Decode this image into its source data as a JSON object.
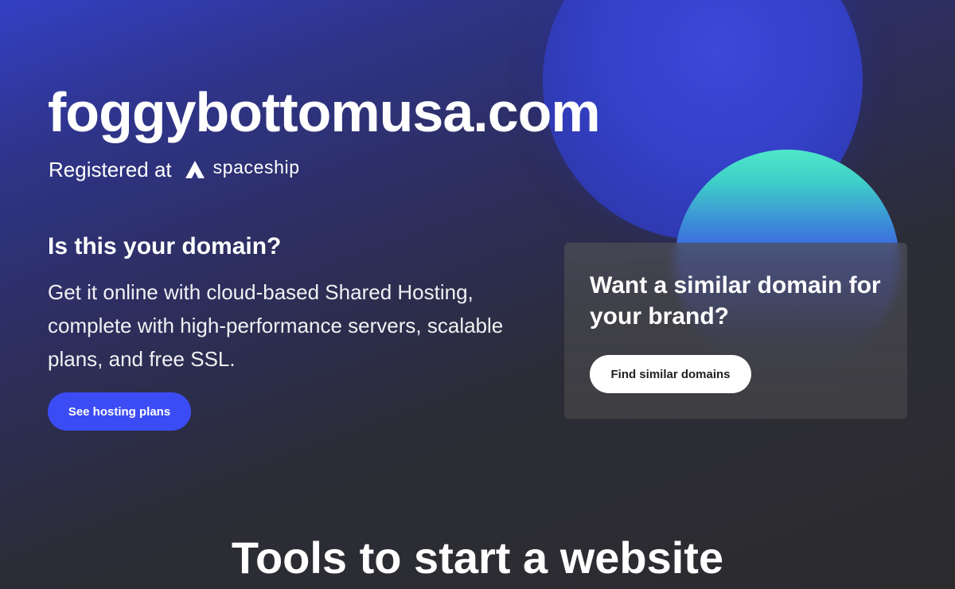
{
  "hero": {
    "domain": "foggybottomusa.com",
    "registered_label": "Registered at",
    "registrar": "spaceship",
    "registrar_logo_icon": "spaceship-logo-icon"
  },
  "question": {
    "heading": "Is this your domain?",
    "body": "Get it online with cloud-based Shared Hosting, complete with high-performance servers, scalable plans, and free SSL.",
    "button_label": "See hosting plans"
  },
  "similar_card": {
    "heading": "Want a similar domain for your brand?",
    "button_label": "Find similar domains"
  },
  "tools": {
    "heading": "Tools to start a website"
  },
  "colors": {
    "primary_button": "#3b4cf5",
    "accent_blue": "#3441c8",
    "accent_green": "#4ee7c9",
    "background": "#2b2b2e"
  }
}
